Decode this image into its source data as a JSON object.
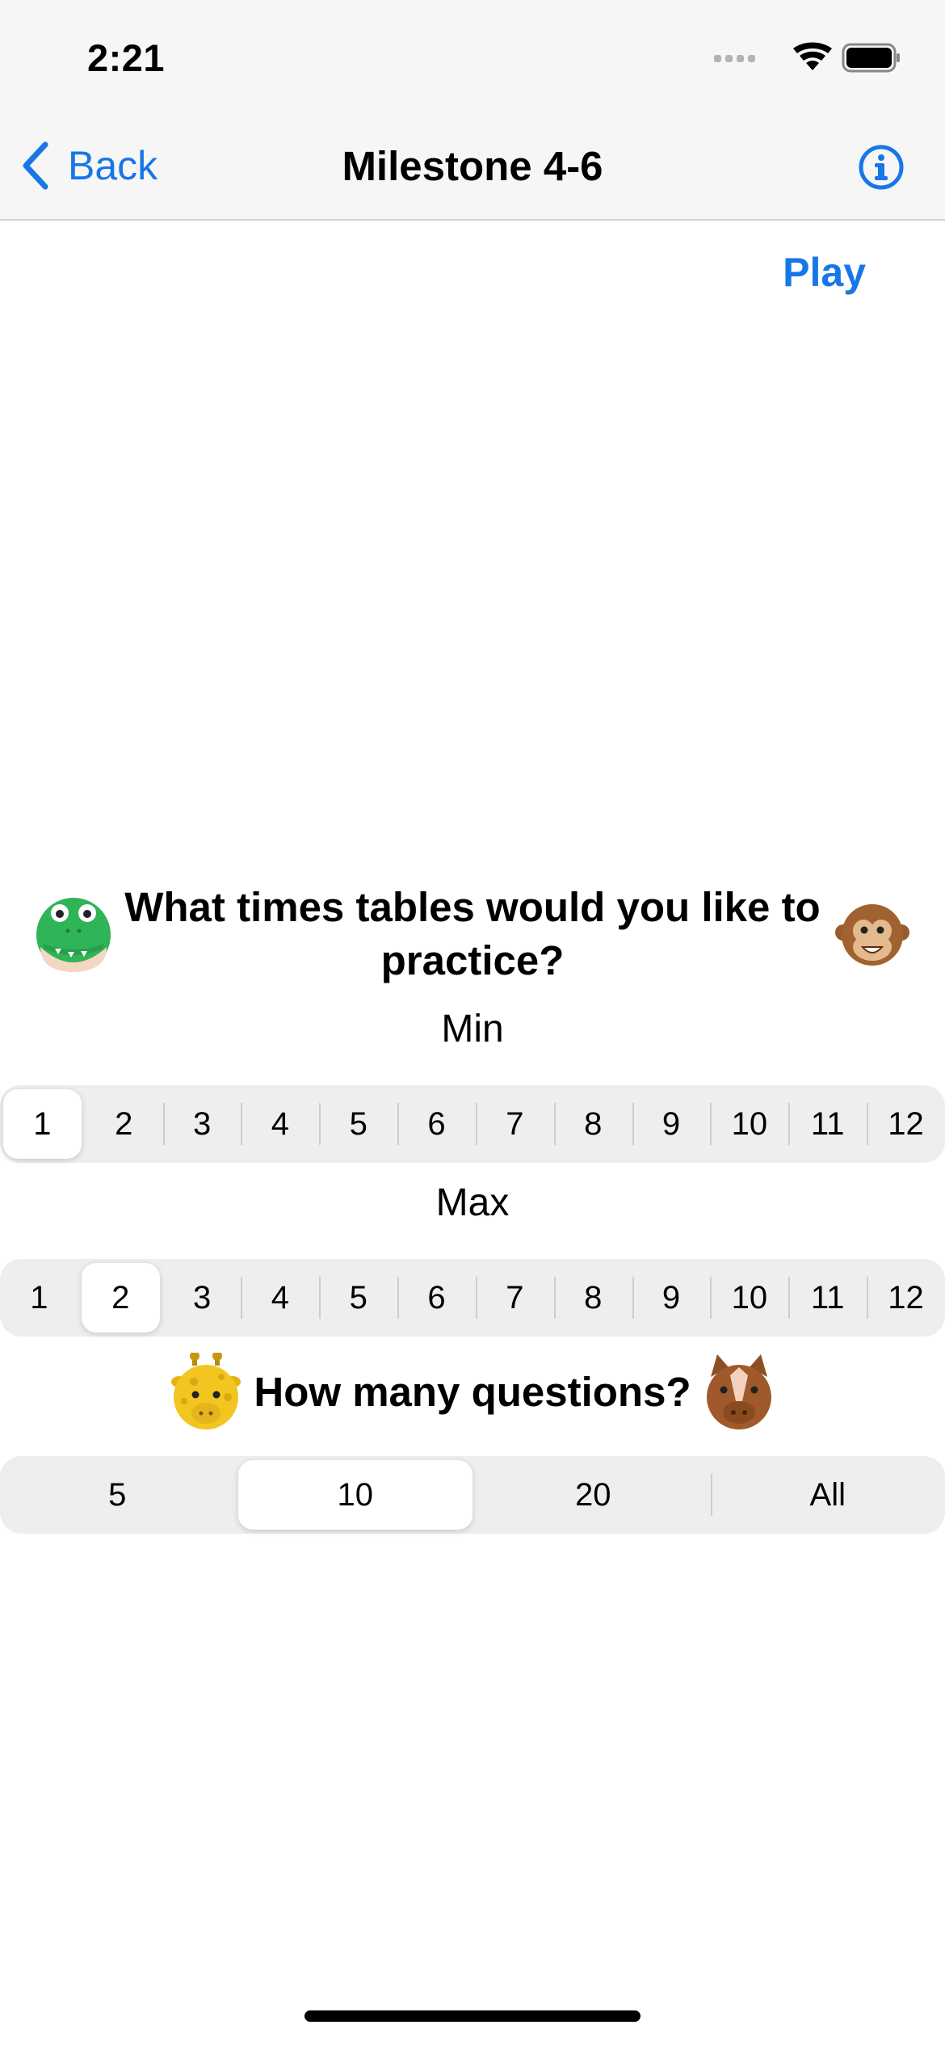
{
  "status_bar": {
    "time": "2:21"
  },
  "nav": {
    "back_label": "Back",
    "title": "Milestone 4-6"
  },
  "play_label": "Play",
  "tables": {
    "question": "What times tables would you like to practice?",
    "min_label": "Min",
    "max_label": "Max",
    "options": [
      "1",
      "2",
      "3",
      "4",
      "5",
      "6",
      "7",
      "8",
      "9",
      "10",
      "11",
      "12"
    ],
    "min_selected": "1",
    "max_selected": "2"
  },
  "questions": {
    "question": "How many questions?",
    "options": [
      "5",
      "10",
      "20",
      "All"
    ],
    "selected": "10"
  },
  "colors": {
    "accent": "#1877e6",
    "segment_bg": "#eeeeef"
  },
  "icons": [
    "chevron-left-icon",
    "info-icon",
    "crocodile-icon",
    "monkey-icon",
    "giraffe-icon",
    "horse-icon"
  ]
}
